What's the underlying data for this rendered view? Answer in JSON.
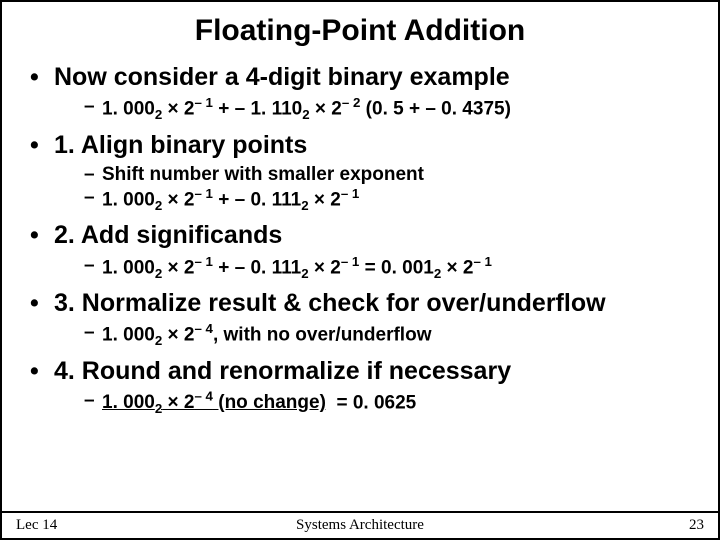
{
  "title": "Floating-Point Addition",
  "bullets": [
    {
      "text": "Now consider a 4-digit binary example",
      "subs": [
        {
          "html": "1. 000<sub>2</sub> × 2<sup>– 1</sup> + – 1. 110<sub>2</sub> × 2<sup>– 2</sup> (0. 5 + – 0. 4375)"
        }
      ]
    },
    {
      "text": "1. Align binary points",
      "subs": [
        {
          "html": "Shift number with smaller exponent"
        },
        {
          "html": "1. 000<sub>2</sub> × 2<sup>– 1</sup> + – 0. 111<sub>2</sub> × 2<sup>– 1</sup>"
        }
      ]
    },
    {
      "text": "2. Add significands",
      "subs": [
        {
          "html": "1. 000<sub>2</sub> × 2<sup>– 1</sup> + – 0. 111<sub>2</sub> × 2<sup>– 1</sup> = 0. 001<sub>2</sub> × 2<sup>– 1</sup>"
        }
      ]
    },
    {
      "text": "3. Normalize result & check for over/underflow",
      "subs": [
        {
          "html": "1. 000<sub>2</sub> × 2<sup>– 4</sup>, with no over/underflow"
        }
      ]
    },
    {
      "text": "4. Round and renormalize if necessary",
      "subs": [
        {
          "html": "<span style=\"text-decoration: underline;\">1. 000<sub>2</sub> × 2<sup>– 4</sup> (no change)</span>&nbsp; = 0. 0625"
        }
      ]
    }
  ],
  "footer": {
    "left": "Lec 14",
    "center": "Systems Architecture",
    "right": "23"
  }
}
